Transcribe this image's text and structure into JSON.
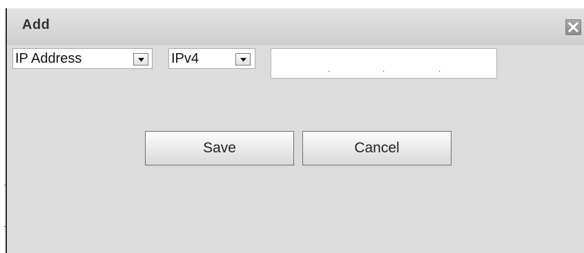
{
  "dialog": {
    "title": "Add",
    "close_icon": "close-icon"
  },
  "filter": {
    "type_select": {
      "value": "IP Address"
    },
    "version_select": {
      "value": "IPv4"
    },
    "ip_address": {
      "value": "",
      "separators": [
        ".",
        ".",
        "."
      ]
    }
  },
  "actions": {
    "save_label": "Save",
    "cancel_label": "Cancel"
  },
  "colors": {
    "dialog_bg": "#dcdcdc",
    "titlebar_bg": "#d6d6d6",
    "close_bg": "#9a9a9a",
    "button_border": "#6e6e6e"
  }
}
